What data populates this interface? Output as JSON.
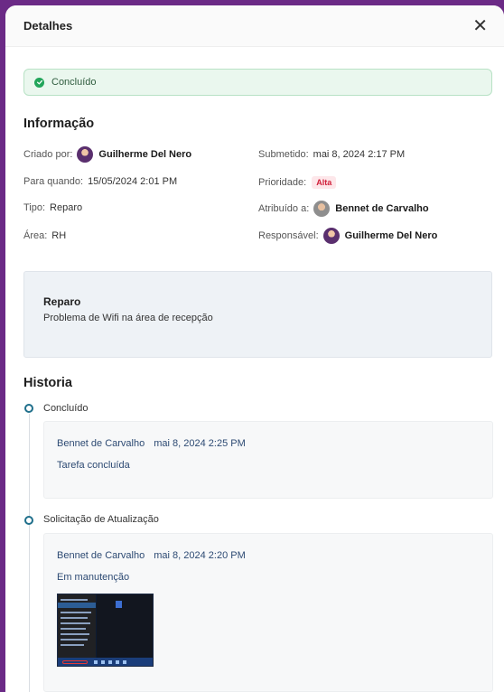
{
  "header": {
    "title": "Detalhes",
    "close_label": "✕"
  },
  "status": {
    "label": "Concluído",
    "color": "#22a55a"
  },
  "info": {
    "section_title": "Informação",
    "criado_por": {
      "label": "Criado por:",
      "value": "Guilherme Del Nero"
    },
    "submetido": {
      "label": "Submetido:",
      "value": "mai 8, 2024 2:17 PM"
    },
    "para_quando": {
      "label": "Para quando:",
      "value": "15/05/2024 2:01 PM"
    },
    "prioridade": {
      "label": "Prioridade:",
      "value": "Alta",
      "color": "#d0203a"
    },
    "tipo": {
      "label": "Tipo:",
      "value": "Reparo"
    },
    "atribuido": {
      "label": "Atribuído a:",
      "value": "Bennet de Carvalho"
    },
    "area": {
      "label": "Área:",
      "value": "RH"
    },
    "responsavel": {
      "label": "Responsável:",
      "value": "Guilherme Del Nero"
    }
  },
  "description": {
    "title": "Reparo",
    "text": "Problema de Wifi na área de recepção"
  },
  "history": {
    "section_title": "Historia",
    "entries": [
      {
        "status": "Concluído",
        "author": "Bennet de Carvalho",
        "date": "mai 8, 2024 2:25 PM",
        "message": "Tarefa concluída"
      },
      {
        "status": "Solicitação de Atualização",
        "author": "Bennet de Carvalho",
        "date": "mai 8, 2024 2:20 PM",
        "message": "Em manutenção",
        "attachment": "screenshot-thumbnail"
      }
    ]
  }
}
